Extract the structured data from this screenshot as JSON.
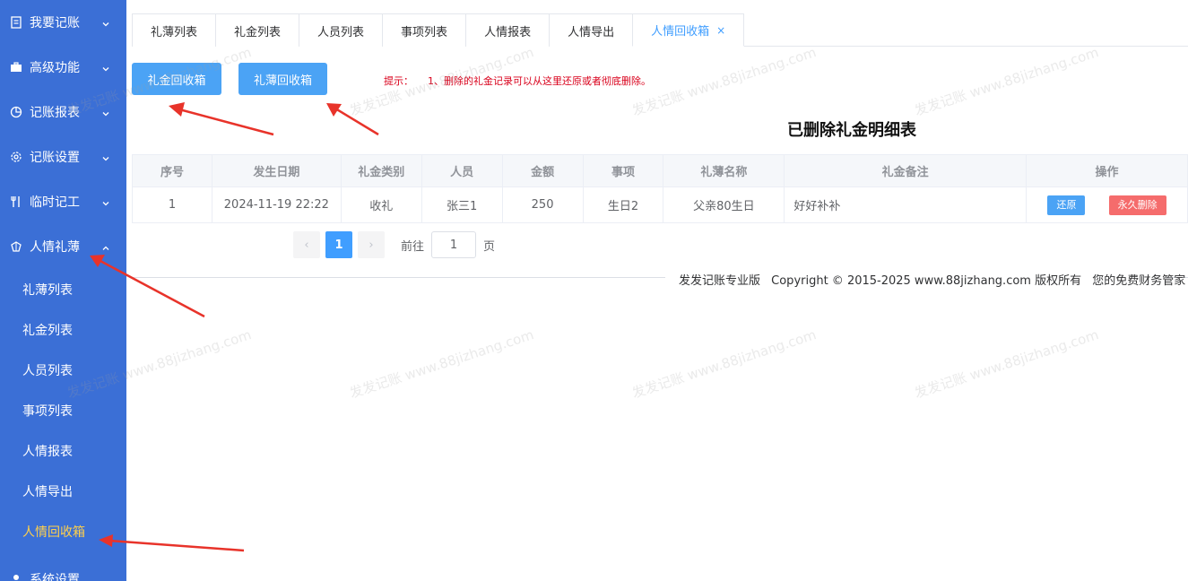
{
  "sidebar": {
    "items": [
      {
        "label": "我要记账",
        "icon": "document-icon",
        "expanded": false
      },
      {
        "label": "高级功能",
        "icon": "briefcase-icon",
        "expanded": false
      },
      {
        "label": "记账报表",
        "icon": "pie-chart-icon",
        "expanded": false
      },
      {
        "label": "记账设置",
        "icon": "gear-icon",
        "expanded": false
      },
      {
        "label": "临时记工",
        "icon": "tools-icon",
        "expanded": false
      },
      {
        "label": "人情礼薄",
        "icon": "gift-icon",
        "expanded": true
      }
    ],
    "sub_items": [
      "礼薄列表",
      "礼金列表",
      "人员列表",
      "事项列表",
      "人情报表",
      "人情导出",
      "人情回收箱"
    ],
    "active_sub": "人情回收箱",
    "partial_next": "系统设置"
  },
  "tabs": [
    {
      "label": "礼薄列表"
    },
    {
      "label": "礼金列表"
    },
    {
      "label": "人员列表"
    },
    {
      "label": "事项列表"
    },
    {
      "label": "人情报表"
    },
    {
      "label": "人情导出"
    },
    {
      "label": "人情回收箱",
      "active": true,
      "close": "×"
    }
  ],
  "toolbar": {
    "gift_money_bin": "礼金回收箱",
    "gift_book_bin": "礼薄回收箱",
    "tip_label": "提示：",
    "tip_text": "1、删除的礼金记录可以从这里还原或者彻底删除。"
  },
  "table": {
    "title": "已删除礼金明细表",
    "headers": [
      "序号",
      "发生日期",
      "礼金类别",
      "人员",
      "金额",
      "事项",
      "礼薄名称",
      "礼金备注",
      "操作"
    ],
    "rows": [
      {
        "index": "1",
        "date": "2024-11-19 22:22",
        "category": "收礼",
        "person": "张三1",
        "amount": "250",
        "event": "生日2",
        "book": "父亲80生日",
        "note": "好好补补"
      }
    ],
    "actions": {
      "restore": "还原",
      "delete": "永久删除"
    }
  },
  "pager": {
    "prev": "‹",
    "current": "1",
    "next": "›",
    "goto_label": "前往",
    "goto_value": "1",
    "unit": "页"
  },
  "footer": {
    "brand": "发发记账专业版",
    "copyright": "Copyright © 2015-2025 www.88jizhang.com 版权所有",
    "slogan": "您的免费财务管家"
  },
  "watermark": "发发记账 www.88jizhang.com",
  "colors": {
    "sidebar_bg": "#3b6fd6",
    "accent": "#409eff",
    "active_sub": "#ffd04b",
    "danger": "#f56c6c",
    "tip": "#d9001b",
    "arrow": "#e8332a"
  }
}
